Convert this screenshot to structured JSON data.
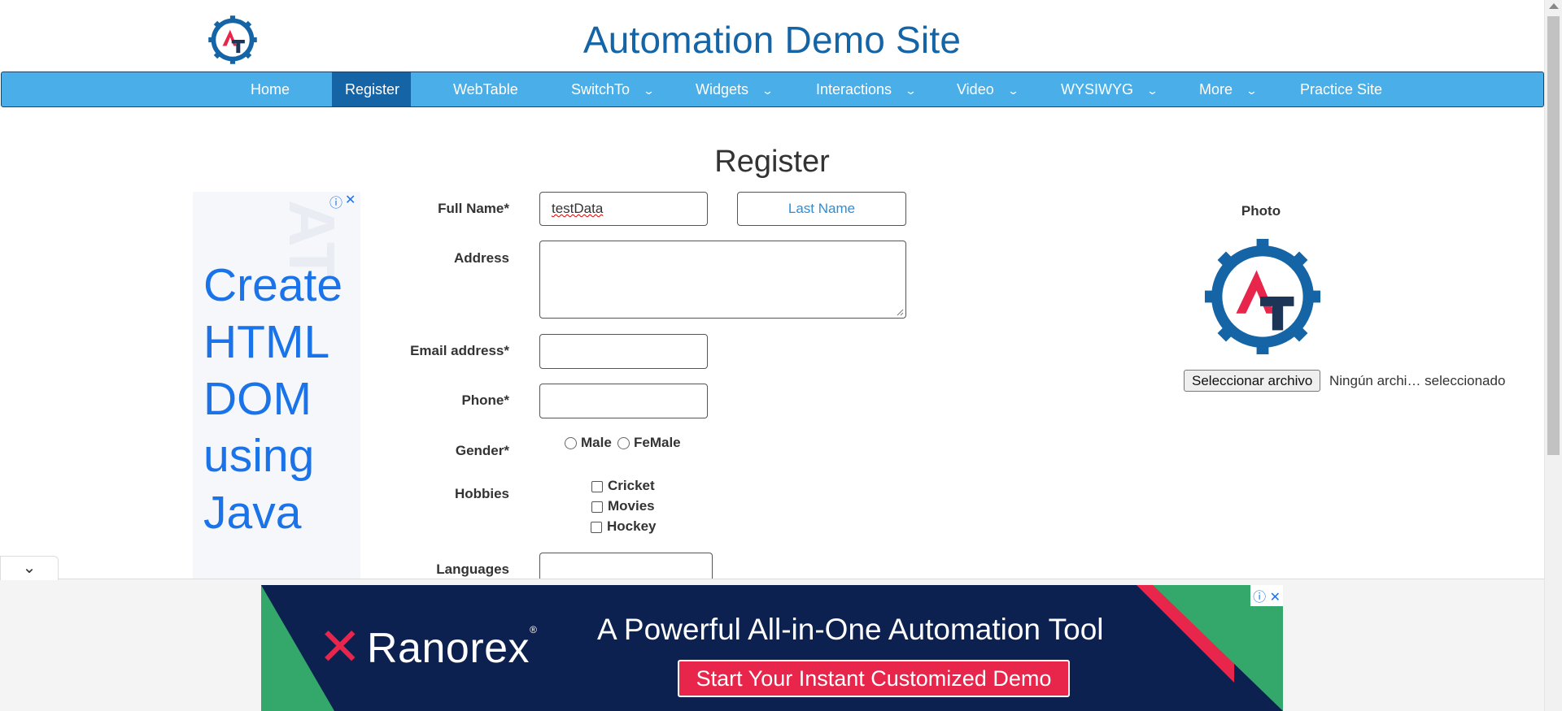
{
  "header": {
    "title": "Automation Demo Site",
    "logo_letters": "AT"
  },
  "nav": {
    "items": [
      {
        "label": "Home",
        "dropdown": false,
        "active": false
      },
      {
        "label": "Register",
        "dropdown": false,
        "active": true
      },
      {
        "label": "WebTable",
        "dropdown": false,
        "active": false
      },
      {
        "label": "SwitchTo",
        "dropdown": true,
        "active": false
      },
      {
        "label": "Widgets",
        "dropdown": true,
        "active": false
      },
      {
        "label": "Interactions",
        "dropdown": true,
        "active": false
      },
      {
        "label": "Video",
        "dropdown": true,
        "active": false
      },
      {
        "label": "WYSIWYG",
        "dropdown": true,
        "active": false
      },
      {
        "label": "More",
        "dropdown": true,
        "active": false
      },
      {
        "label": "Practice Site",
        "dropdown": false,
        "active": false
      }
    ],
    "caret_glyph": "⌄"
  },
  "form": {
    "heading": "Register",
    "full_name_label": "Full Name*",
    "first_name_value": "testData",
    "last_name_placeholder": "Last Name",
    "address_label": "Address",
    "email_label": "Email address*",
    "phone_label": "Phone*",
    "gender_label": "Gender*",
    "gender_options": [
      "Male",
      "FeMale"
    ],
    "hobbies_label": "Hobbies",
    "hobbies": [
      "Cricket",
      "Movies",
      "Hockey"
    ],
    "languages_label": "Languages"
  },
  "photo": {
    "label": "Photo",
    "file_button": "Seleccionar archivo",
    "file_status": "Ningún archi… seleccionado"
  },
  "side_ad": {
    "text": "Create HTML DOM using Java",
    "info_icon": "ⓘ",
    "close_icon": "✕"
  },
  "bottom_ad": {
    "brand": "Ranorex",
    "registered": "®",
    "headline": "A Powerful All-in-One Automation Tool",
    "cta": "Start Your Instant Customized Demo",
    "info_icon": "ⓘ",
    "close_icon": "✕",
    "collapse_glyph": "⌄"
  },
  "colors": {
    "brand_blue": "#1565a6",
    "nav_bg": "#4aaee8",
    "accent_red": "#e8254a",
    "ad_navy": "#0c2150"
  }
}
